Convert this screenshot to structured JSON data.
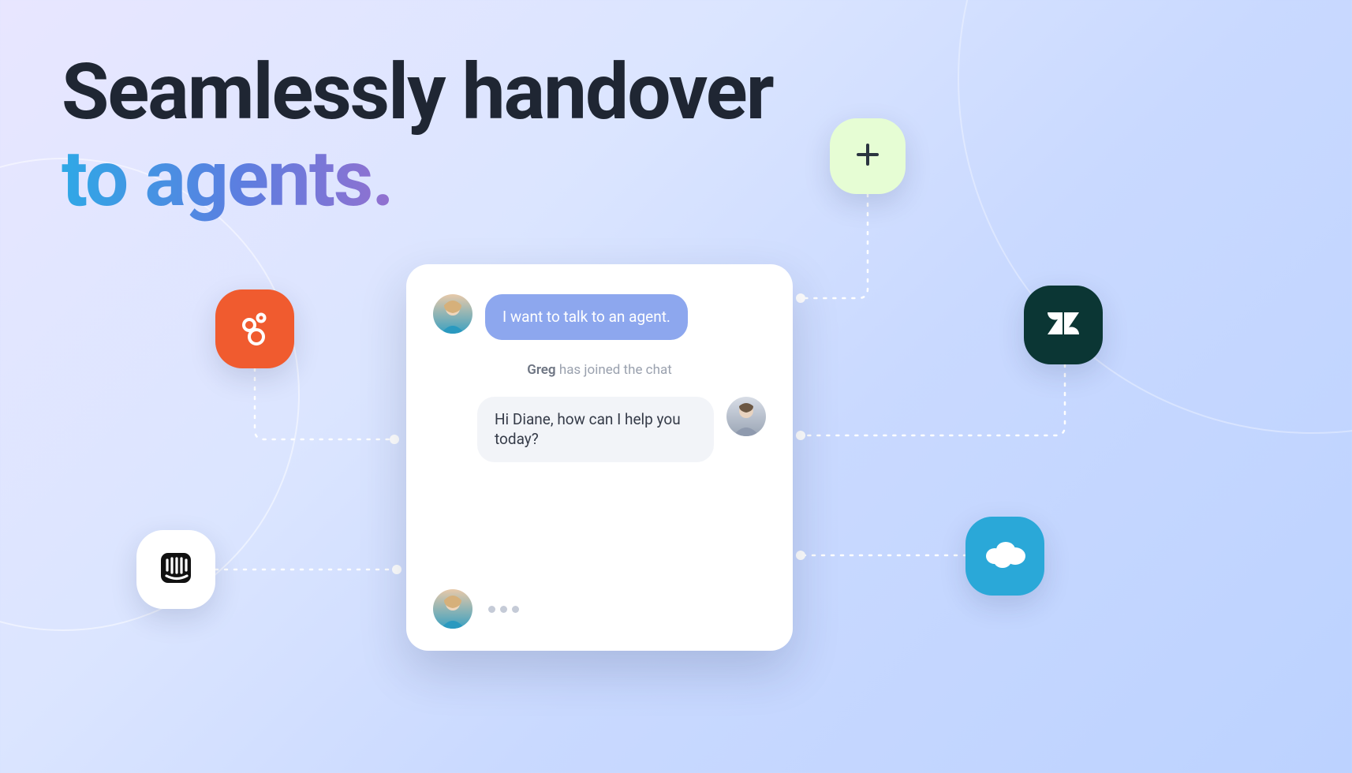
{
  "headline": {
    "line1": "Seamlessly handover",
    "line2": "to agents."
  },
  "chat": {
    "user_message": "I want to talk to an agent.",
    "system_name": "Greg",
    "system_suffix": " has joined the chat",
    "agent_message": "Hi Diane, how can I help you today?"
  },
  "integrations": {
    "orange": "gorgias-icon",
    "white": "intercom-icon",
    "mint": "plus-icon",
    "dark": "zendesk-icon",
    "blue": "salesforce-icon"
  }
}
